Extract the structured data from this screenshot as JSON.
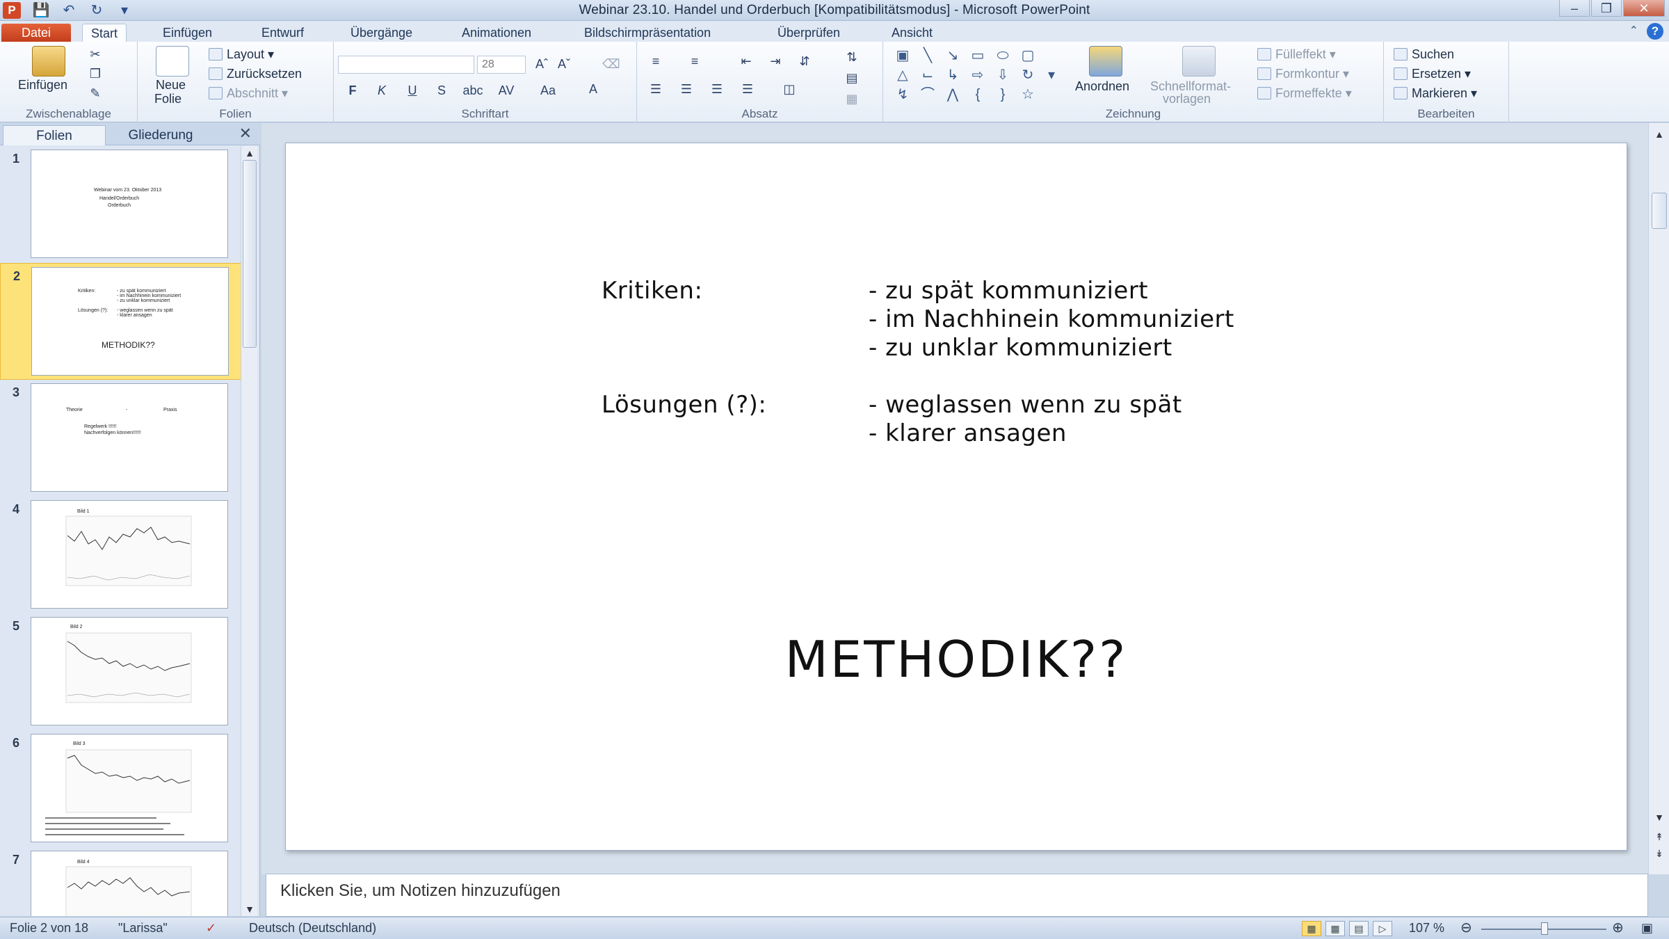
{
  "titlebar": {
    "title": "Webinar 23.10. Handel und Orderbuch [Kompatibilitätsmodus] - Microsoft PowerPoint",
    "logo": "P",
    "qat": [
      "save-icon",
      "undo-icon",
      "redo-icon",
      "customize-icon"
    ],
    "window_buttons": [
      "minimize",
      "restore",
      "close"
    ]
  },
  "tabs": {
    "file": "Datei",
    "items": [
      "Start",
      "Einfügen",
      "Entwurf",
      "Übergänge",
      "Animationen",
      "Bildschirmpräsentation",
      "Überprüfen",
      "Ansicht"
    ],
    "active": "Start"
  },
  "ribbon": {
    "clipboard": {
      "label": "Zwischenablage",
      "paste": "Einfügen"
    },
    "slides": {
      "label": "Folien",
      "new_slide_1": "Neue",
      "new_slide_2": "Folie",
      "layout": "Layout",
      "reset": "Zurücksetzen",
      "section": "Abschnitt"
    },
    "font": {
      "label": "Schriftart",
      "size": "28",
      "bold": "F",
      "italic": "K",
      "underline": "U",
      "strike": "S",
      "shadow": "abc",
      "spacing": "AV",
      "case": "Aa",
      "color": "A"
    },
    "paragraph": {
      "label": "Absatz"
    },
    "drawing": {
      "label": "Zeichnung",
      "arrange": "Anordnen",
      "quick_styles_1": "Schnellformat-",
      "quick_styles_2": "vorlagen",
      "fill": "Fülleffekt",
      "outline": "Formkontur",
      "effects": "Formeffekte"
    },
    "editing": {
      "label": "Bearbeiten",
      "find": "Suchen",
      "replace": "Ersetzen",
      "select": "Markieren"
    }
  },
  "left_pane": {
    "tab_slides": "Folien",
    "tab_outline": "Gliederung",
    "close": "✕",
    "thumbnails": [
      {
        "num": "1",
        "lines": [
          "Webinar vom 23. Oktober 2013",
          "Handel/Orderbuch",
          "Orderbuch"
        ]
      },
      {
        "num": "2",
        "lines": [
          "Kritiken:",
          "- zu spät kommuniziert",
          "- im Nachhinein kommuniziert",
          "- zu unklar kommuniziert",
          "Lösungen (?):",
          "- weglassen wenn zu spät",
          "- klarer ansagen",
          "METHODIK??"
        ]
      },
      {
        "num": "3",
        "lines": [
          "Theorie",
          "-",
          "Praxis",
          "Regelwerk !!!!!!",
          "Nachverfolgen können!!!!!!"
        ]
      },
      {
        "num": "4",
        "lines": [
          "Bild 1"
        ]
      },
      {
        "num": "5",
        "lines": [
          "Bild 2"
        ]
      },
      {
        "num": "6",
        "lines": [
          "Bild 3"
        ]
      },
      {
        "num": "7",
        "lines": [
          "Bild 4"
        ]
      }
    ]
  },
  "slide": {
    "kritiken_label": "Kritiken:",
    "kritiken": [
      "- zu spät kommuniziert",
      "- im Nachhinein kommuniziert",
      "- zu unklar kommuniziert"
    ],
    "loesungen_label": "Lösungen (?):",
    "loesungen": [
      "- weglassen wenn zu spät",
      "- klarer ansagen"
    ],
    "headline": "METHODIK??"
  },
  "notes": {
    "placeholder": "Klicken Sie, um Notizen hinzuzufügen"
  },
  "status": {
    "slide_info": "Folie 2 von 18",
    "theme": "\"Larissa\"",
    "language": "Deutsch (Deutschland)",
    "zoom": "107 %"
  }
}
